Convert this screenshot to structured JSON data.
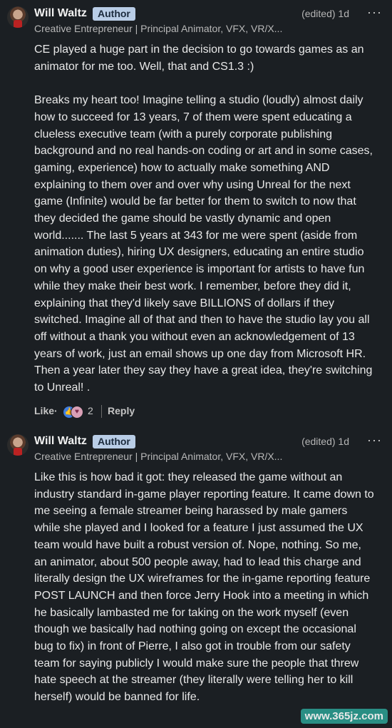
{
  "comments": [
    {
      "name": "Will Waltz",
      "badge": "Author",
      "time": "(edited) 1d",
      "more": "···",
      "subtitle": "Creative Entrepreneur | Principal Animator, VFX, VR/X...",
      "paragraphs": [
        "CE played a huge part in the decision to go towards games as an animator for me too. Well, that and CS1.3 :)",
        "Breaks my heart too! Imagine telling a studio (loudly) almost daily how to succeed for 13 years, 7 of them were spent educating a clueless executive team (with a purely corporate publishing background and no real hands-on coding or art and in some cases, gaming, experience) how to actually make something AND explaining to them over and over why using Unreal for the next game (Infinite) would be far better for them to switch to now that they decided the game should be vastly dynamic and open world....... The last 5 years at 343 for me were spent (aside from animation duties), hiring UX designers, educating an entire studio on why a good user experience is important for artists to have fun while they make their best work. I remember, before they did it, explaining that they'd likely save BILLIONS of dollars if they switched. Imagine all of that and then to have the studio lay you all off without a thank you without even an acknowledgement of 13 years of work, just an email shows up one day from Microsoft HR. Then a year later they say they have a great idea, they're switching to Unreal! ."
      ],
      "actions": {
        "like": "Like",
        "dot": "·",
        "reaction_count": "2",
        "reply": "Reply"
      }
    },
    {
      "name": "Will Waltz",
      "badge": "Author",
      "time": "(edited) 1d",
      "more": "···",
      "subtitle": "Creative Entrepreneur | Principal Animator, VFX, VR/X...",
      "paragraphs": [
        "Like this is how bad it got: they released the game without an industry standard in-game player reporting feature. It came down to me seeing a female streamer being harassed by male gamers while she played and I looked for a feature I just assumed the UX team would have built a robust version of. Nope, nothing. So me, an animator, about 500 people away, had to lead this charge and literally design the UX wireframes for the in-game reporting feature POST LAUNCH and then force Jerry Hook into a meeting in which he basically lambasted me for taking on the work myself (even though we basically had nothing going on except the occasional bug to fix) in front of Pierre, I also got in trouble from our safety team for saying publicly I would make sure the people that threw hate speech at the streamer (they literally were telling her to kill herself) would be banned for life."
      ]
    }
  ],
  "watermark": "www.365jz.com",
  "icons": {
    "reaction_like": "thumbs-up-icon",
    "reaction_love": "heart-icon",
    "more": "ellipsis-icon"
  },
  "colors": {
    "background": "#1b1f23",
    "badge_bg": "#b9cde6",
    "badge_text": "#1b2a3c"
  }
}
